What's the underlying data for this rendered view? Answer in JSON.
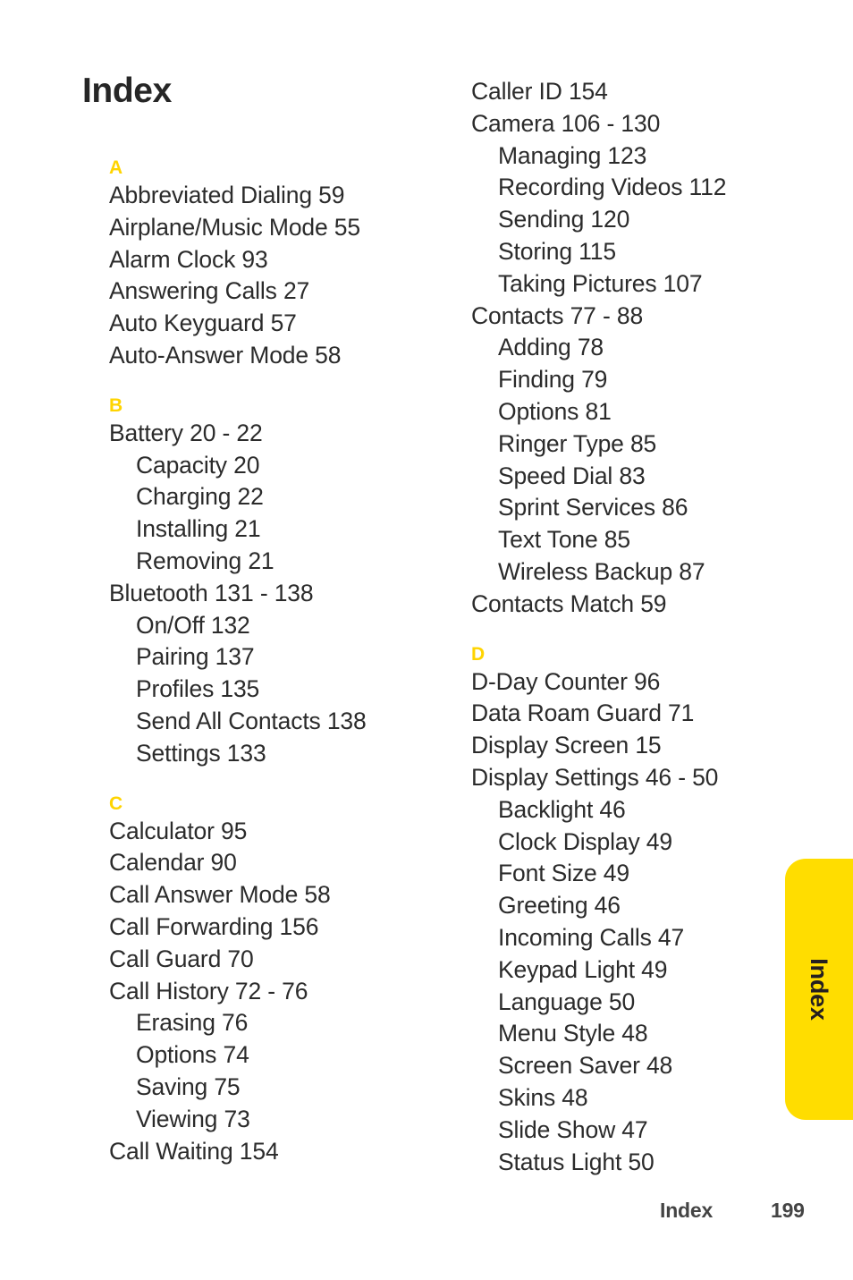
{
  "page": {
    "title": "Index",
    "footer_label": "Index",
    "footer_page": "199",
    "side_tab_label": "Index",
    "accent_color": "#FFD400",
    "tab_color": "#FFDD00",
    "text_color": "#2b2b2b"
  },
  "columns": [
    {
      "name": "left-column",
      "sections": [
        {
          "letter": "A",
          "entries": [
            {
              "text": "Abbreviated Dialing 59",
              "level": 1
            },
            {
              "text": "Airplane/Music Mode 55",
              "level": 1
            },
            {
              "text": "Alarm Clock 93",
              "level": 1
            },
            {
              "text": "Answering Calls 27",
              "level": 1
            },
            {
              "text": "Auto Keyguard 57",
              "level": 1
            },
            {
              "text": "Auto-Answer Mode 58",
              "level": 1
            }
          ]
        },
        {
          "letter": "B",
          "entries": [
            {
              "text": "Battery 20 - 22",
              "level": 1
            },
            {
              "text": "Capacity 20",
              "level": 2
            },
            {
              "text": "Charging 22",
              "level": 2
            },
            {
              "text": "Installing 21",
              "level": 2
            },
            {
              "text": "Removing 21",
              "level": 2
            },
            {
              "text": "Bluetooth 131 - 138",
              "level": 1
            },
            {
              "text": "On/Off 132",
              "level": 2
            },
            {
              "text": "Pairing 137",
              "level": 2
            },
            {
              "text": "Profiles 135",
              "level": 2
            },
            {
              "text": "Send All Contacts 138",
              "level": 2
            },
            {
              "text": "Settings 133",
              "level": 2
            }
          ]
        },
        {
          "letter": "C",
          "entries": [
            {
              "text": "Calculator 95",
              "level": 1
            },
            {
              "text": "Calendar 90",
              "level": 1
            },
            {
              "text": "Call Answer Mode 58",
              "level": 1
            },
            {
              "text": "Call Forwarding 156",
              "level": 1
            },
            {
              "text": "Call Guard 70",
              "level": 1
            },
            {
              "text": "Call History 72 - 76",
              "level": 1
            },
            {
              "text": "Erasing 76",
              "level": 2
            },
            {
              "text": "Options 74",
              "level": 2
            },
            {
              "text": "Saving 75",
              "level": 2
            },
            {
              "text": "Viewing 73",
              "level": 2
            },
            {
              "text": "Call Waiting 154",
              "level": 1
            }
          ]
        }
      ]
    },
    {
      "name": "right-column",
      "sections": [
        {
          "letter": "",
          "entries": [
            {
              "text": "Caller ID 154",
              "level": 1
            },
            {
              "text": "Camera 106 - 130",
              "level": 1
            },
            {
              "text": "Managing 123",
              "level": 2
            },
            {
              "text": "Recording Videos 112",
              "level": 2
            },
            {
              "text": "Sending 120",
              "level": 2
            },
            {
              "text": "Storing 115",
              "level": 2
            },
            {
              "text": "Taking Pictures 107",
              "level": 2
            },
            {
              "text": "Contacts 77 - 88",
              "level": 1
            },
            {
              "text": "Adding 78",
              "level": 2
            },
            {
              "text": "Finding 79",
              "level": 2
            },
            {
              "text": "Options 81",
              "level": 2
            },
            {
              "text": "Ringer Type 85",
              "level": 2
            },
            {
              "text": "Speed Dial 83",
              "level": 2
            },
            {
              "text": "Sprint Services 86",
              "level": 2
            },
            {
              "text": "Text Tone 85",
              "level": 2
            },
            {
              "text": "Wireless Backup 87",
              "level": 2
            },
            {
              "text": "Contacts Match 59",
              "level": 1
            }
          ]
        },
        {
          "letter": "D",
          "entries": [
            {
              "text": "D-Day Counter 96",
              "level": 1
            },
            {
              "text": "Data Roam Guard 71",
              "level": 1
            },
            {
              "text": "Display Screen 15",
              "level": 1
            },
            {
              "text": "Display Settings 46 - 50",
              "level": 1
            },
            {
              "text": "Backlight 46",
              "level": 2
            },
            {
              "text": "Clock Display 49",
              "level": 2
            },
            {
              "text": "Font Size 49",
              "level": 2
            },
            {
              "text": "Greeting 46",
              "level": 2
            },
            {
              "text": "Incoming Calls 47",
              "level": 2
            },
            {
              "text": "Keypad Light 49",
              "level": 2
            },
            {
              "text": "Language 50",
              "level": 2
            },
            {
              "text": "Menu Style 48",
              "level": 2
            },
            {
              "text": "Screen Saver 48",
              "level": 2
            },
            {
              "text": "Skins 48",
              "level": 2
            },
            {
              "text": "Slide Show 47",
              "level": 2
            },
            {
              "text": "Status Light 50",
              "level": 2
            }
          ]
        }
      ]
    }
  ]
}
